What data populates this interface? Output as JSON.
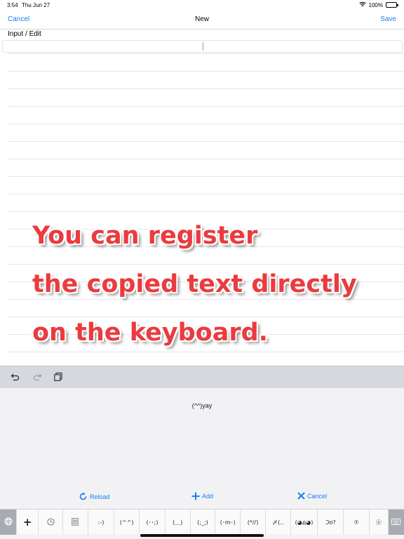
{
  "status": {
    "time": "3:54",
    "date": "Thu Jun 27",
    "battery": "100%",
    "battery_level": 100
  },
  "nav": {
    "cancel_label": "Cancel",
    "title": "New",
    "save_label": "Save"
  },
  "editor": {
    "section_label": "Input / Edit",
    "input_value": ""
  },
  "overlay": {
    "lines": [
      "You can register",
      "the copied text directly",
      "on the keyboard."
    ],
    "color": "#ea3b3f"
  },
  "toolbar": {
    "icons": [
      "undo-icon",
      "redo-icon",
      "paste-icon"
    ]
  },
  "keyboard": {
    "clipboard_item": "(^^)yay",
    "actions": {
      "reload": "Reload",
      "add": "Add",
      "cancel": "Cancel"
    },
    "keys": [
      ":-)",
      "(^^)",
      "(･･;)",
      "(＿)",
      "(;_;)",
      "(･m･)",
      "(*//)",
      "〆(..",
      "(◕д◕)",
      "ℑ︎ʊ?",
      "⑦",
      "ⓐ"
    ],
    "key_icons": [
      "globe-icon",
      "plus-icon",
      "history-icon",
      "notepad-icon",
      "keyboard-icon"
    ]
  },
  "colors": {
    "accent": "#1a7cf5",
    "toolbar": "#d7d8de",
    "keyboard_bg": "#f2f2f4"
  }
}
